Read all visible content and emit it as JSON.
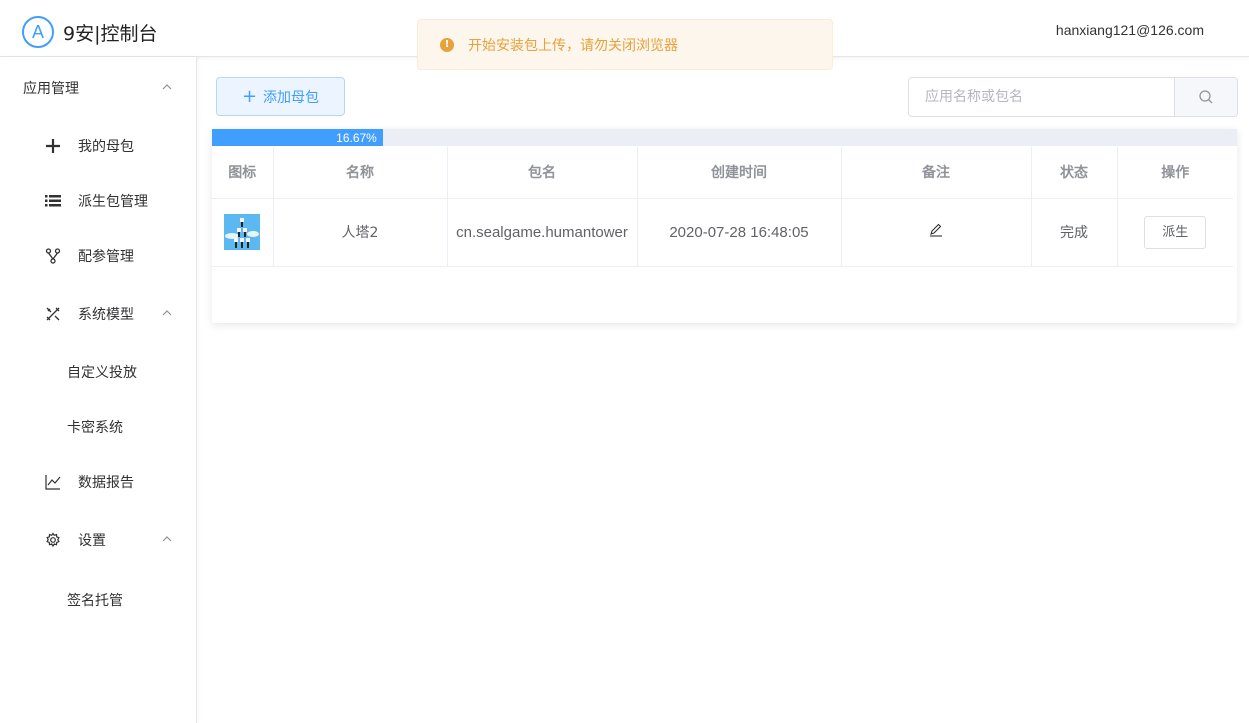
{
  "header": {
    "logo_letter": "A",
    "title": "9安|控制台",
    "user_email": "hanxiang121@126.com"
  },
  "toast": {
    "message": "开始安装包上传，请勿关闭浏览器",
    "icon": "warning-icon"
  },
  "sidebar": {
    "items": [
      {
        "label": "应用管理",
        "type": "group",
        "icon": "chevron-up-icon"
      },
      {
        "label": "我的母包",
        "type": "item",
        "icon": "plus-icon"
      },
      {
        "label": "派生包管理",
        "type": "item",
        "icon": "list-icon"
      },
      {
        "label": "配参管理",
        "type": "item",
        "icon": "branch-icon"
      },
      {
        "label": "系统模型",
        "type": "item",
        "icon": "tools-icon"
      },
      {
        "label": "自定义投放",
        "type": "sub"
      },
      {
        "label": "卡密系统",
        "type": "sub"
      },
      {
        "label": "数据报告",
        "type": "item",
        "icon": "chart-line-icon"
      },
      {
        "label": "设置",
        "type": "item",
        "icon": "gear-icon"
      },
      {
        "label": "签名托管",
        "type": "sub"
      }
    ]
  },
  "toolbar": {
    "add_label": "添加母包",
    "search_placeholder": "应用名称或包名"
  },
  "progress": {
    "percent": 16.67,
    "label": "16.67%"
  },
  "table": {
    "headers": [
      "图标",
      "名称",
      "包名",
      "创建时间",
      "备注",
      "状态",
      "操作"
    ],
    "rows": [
      {
        "name": "人塔2",
        "package": "cn.sealgame.humantower",
        "created": "2020-07-28 16:48:05",
        "note_icon": "edit-icon",
        "status": "完成",
        "action": "派生"
      }
    ]
  },
  "colors": {
    "primary": "#409eff",
    "warning": "#e6a23c",
    "warning_bg": "#fdf6ec"
  }
}
